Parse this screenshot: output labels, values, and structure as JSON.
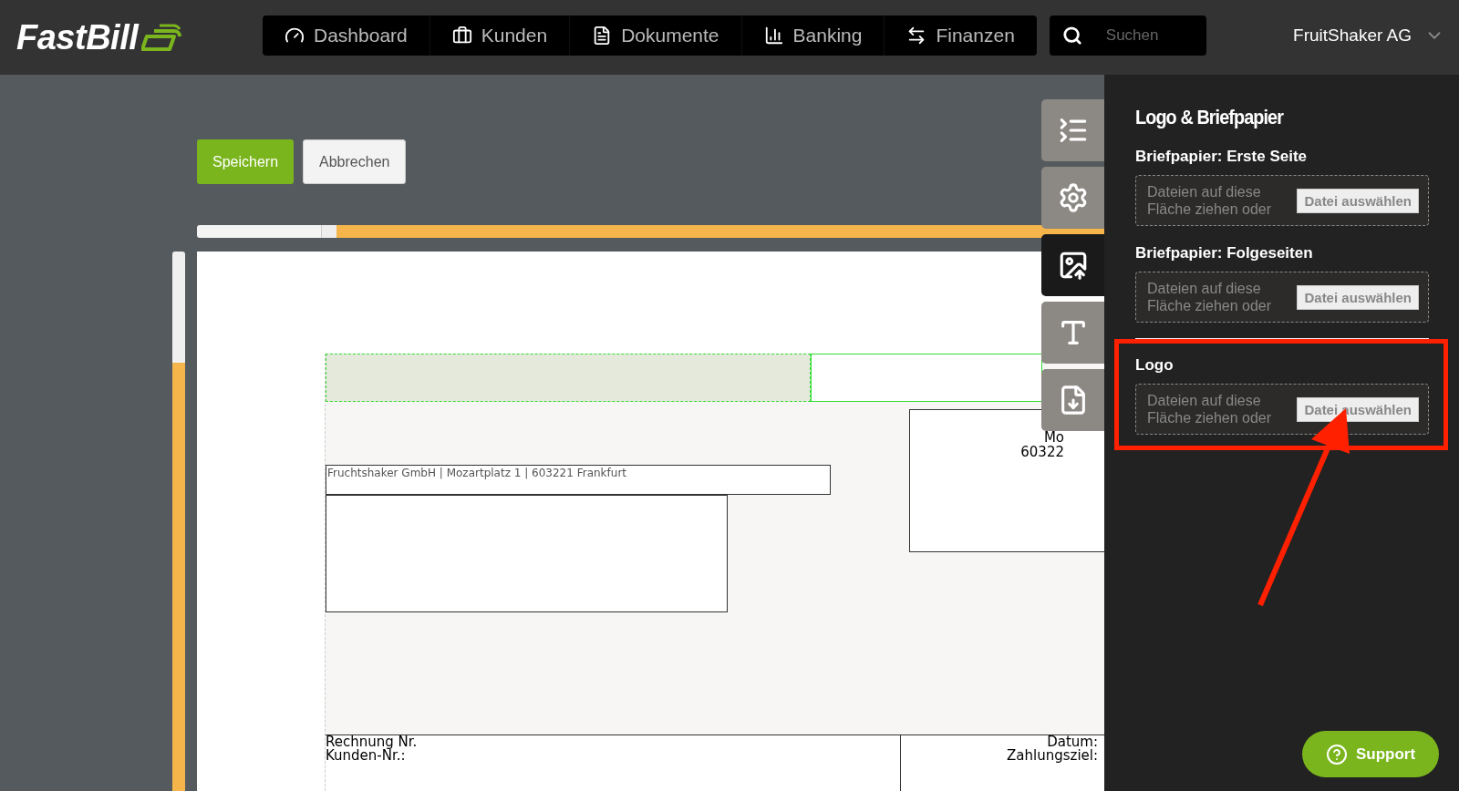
{
  "header": {
    "logo": "FastBill",
    "nav": [
      {
        "label": "Dashboard"
      },
      {
        "label": "Kunden"
      },
      {
        "label": "Dokumente"
      },
      {
        "label": "Banking"
      },
      {
        "label": "Finanzen"
      }
    ],
    "search": {
      "placeholder": "Suchen"
    },
    "account": "FruitShaker AG"
  },
  "toolbar": {
    "buttons": [
      {
        "label": "Speichern",
        "kind": "primary"
      },
      {
        "label": "Abbrechen",
        "kind": "secondary"
      }
    ]
  },
  "side_tabs": [
    {
      "selected": false
    },
    {
      "selected": false
    },
    {
      "selected": true
    },
    {
      "selected": false
    },
    {
      "selected": false
    }
  ],
  "document": {
    "sender_line": "Fruchtshaker GmbH | Mozartplatz 1 | 603221 Frankfurt",
    "recipient_lines": [
      "Mo",
      "60322"
    ],
    "info_left": [
      "Rechnung Nr.",
      "Kunden-Nr.:"
    ],
    "info_right": [
      "Datum:",
      "Zahlungsziel:"
    ]
  },
  "panel": {
    "title": "Logo & Briefpapier",
    "sections": [
      {
        "heading": "Briefpapier: Erste Seite",
        "dropzone": "Dateien auf diese Fläche ziehen oder",
        "button": "Datei auswählen",
        "highlighted": false
      },
      {
        "heading": "Briefpapier: Folgeseiten",
        "dropzone": "Dateien auf diese Fläche ziehen oder",
        "button": "Datei auswählen",
        "highlighted": false
      },
      {
        "heading": "Logo",
        "dropzone": "Dateien auf diese Fläche ziehen oder",
        "button": "Datei auswählen",
        "highlighted": true
      }
    ]
  },
  "support": "Support"
}
